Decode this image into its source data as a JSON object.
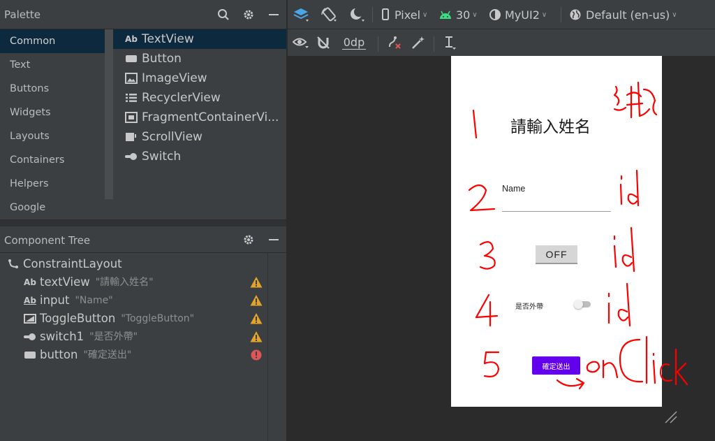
{
  "palette": {
    "title": "Palette",
    "categories": [
      "Common",
      "Text",
      "Buttons",
      "Widgets",
      "Layouts",
      "Containers",
      "Helpers",
      "Google"
    ],
    "selected_category": "Common",
    "items": [
      {
        "icon": "textview-icon",
        "glyph": "Ab",
        "label": "TextView"
      },
      {
        "icon": "button-icon",
        "glyph": "",
        "label": "Button"
      },
      {
        "icon": "imageview-icon",
        "glyph": "",
        "label": "ImageView"
      },
      {
        "icon": "recyclerview-icon",
        "glyph": "",
        "label": "RecyclerView"
      },
      {
        "icon": "fragment-icon",
        "glyph": "",
        "label": "FragmentContainerVi..."
      },
      {
        "icon": "scrollview-icon",
        "glyph": "",
        "label": "ScrollView"
      },
      {
        "icon": "switch-icon",
        "glyph": "",
        "label": "Switch"
      }
    ]
  },
  "component_tree": {
    "title": "Component Tree",
    "root": "ConstraintLayout",
    "nodes": [
      {
        "glyph": "Ab",
        "icon": "textview-icon",
        "name": "textView",
        "text": "\"請輸入姓名\"",
        "status": "warning"
      },
      {
        "glyph": "Ab",
        "icon": "edittext-icon",
        "name": "input",
        "text": "\"Name\"",
        "status": "warning"
      },
      {
        "glyph": "",
        "icon": "togglebutton-icon",
        "name": "ToggleButton",
        "text": "\"ToggleButton\"",
        "status": "warning"
      },
      {
        "glyph": "",
        "icon": "switch-icon",
        "name": "switch1",
        "text": "\"是否外帶\"",
        "status": "warning"
      },
      {
        "glyph": "",
        "icon": "button-icon",
        "name": "button",
        "text": "\"確定送出\"",
        "status": "error"
      }
    ]
  },
  "toolbar": {
    "device": "Pixel",
    "api": "30",
    "theme": "MyUI2",
    "locale": "Default (en-us)",
    "margin": "0dp"
  },
  "preview": {
    "title": "請輸入姓名",
    "input_hint": "Name",
    "toggle_text": "OFF",
    "switch_text": "是否外帶",
    "button_text": "確定送出",
    "switch_on": false
  },
  "colors": {
    "accent_selected": "#0d293e",
    "button_purple": "#6200ee",
    "warning": "#e2a32c",
    "error": "#e05555",
    "android_green": "#3ddc84",
    "annotation_red": "#ff0000"
  },
  "handwritten_annotations": [
    "1",
    "2",
    "3",
    "4",
    "5",
    "紀錄",
    "id",
    "id",
    "id",
    "onClick"
  ]
}
